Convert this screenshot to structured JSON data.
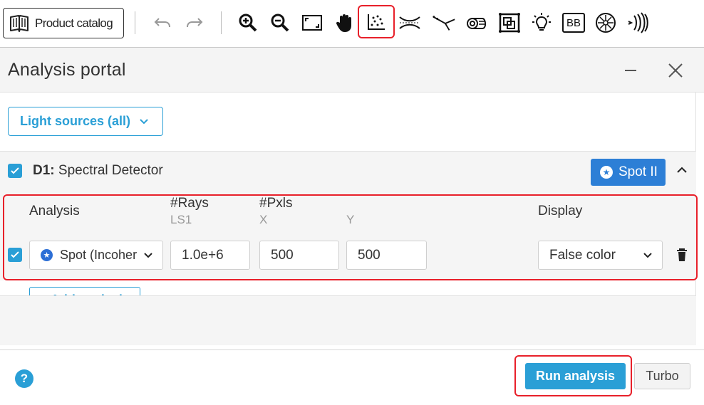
{
  "toolbar": {
    "catalog_label": "Product catalog",
    "icons": [
      "undo-icon",
      "redo-icon",
      "zoom-in-icon",
      "zoom-out-icon",
      "fit-view-icon",
      "pan-hand-icon",
      "spot-diagram-icon",
      "lens-icon",
      "ray-trace-icon",
      "roll-icon",
      "component-icon",
      "light-bulb-icon",
      "bb-icon",
      "detector-icon",
      "waves-icon"
    ],
    "bb_label": "BB"
  },
  "panel": {
    "title": "Analysis portal"
  },
  "light_sources": {
    "label": "Light sources (all)"
  },
  "detector": {
    "id": "D1:",
    "name": "Spectral Detector",
    "spot_button": "Spot II"
  },
  "analysis_table": {
    "headers": {
      "analysis": "Analysis",
      "rays": "#Rays",
      "rays_sub": "LS1",
      "pxls": "#Pxls",
      "pxls_x": "X",
      "pxls_y": "Y",
      "display": "Display"
    },
    "row": {
      "analysis_type": "Spot (Incoher",
      "rays": "1.0e+6",
      "pixels_x": "500",
      "pixels_y": "500",
      "display": "False color"
    }
  },
  "add_analysis_label": "+ Add analysis",
  "footer": {
    "help": "?",
    "run_label": "Run analysis",
    "turbo_label": "Turbo"
  },
  "colors": {
    "accent": "#2a9fd6",
    "spot_button": "#2d7fd6",
    "highlight": "#e8202a"
  }
}
